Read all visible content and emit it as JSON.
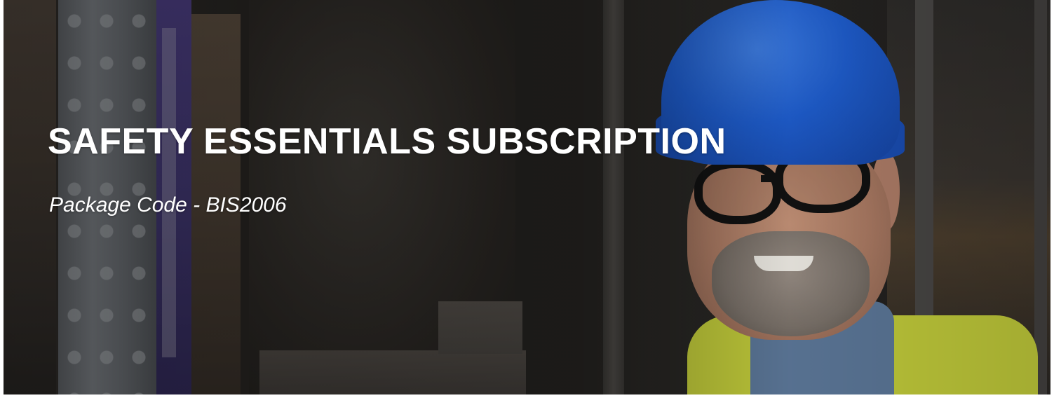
{
  "banner": {
    "title": "SAFETY ESSENTIALS SUBSCRIPTION",
    "subtitle": "Package Code - BIS2006",
    "image_subject": "warehouse-worker-hard-hat-photo"
  },
  "colors": {
    "title_text": "#ffffff",
    "helmet": "#1f5fd2",
    "vest": "#c7d13c"
  }
}
